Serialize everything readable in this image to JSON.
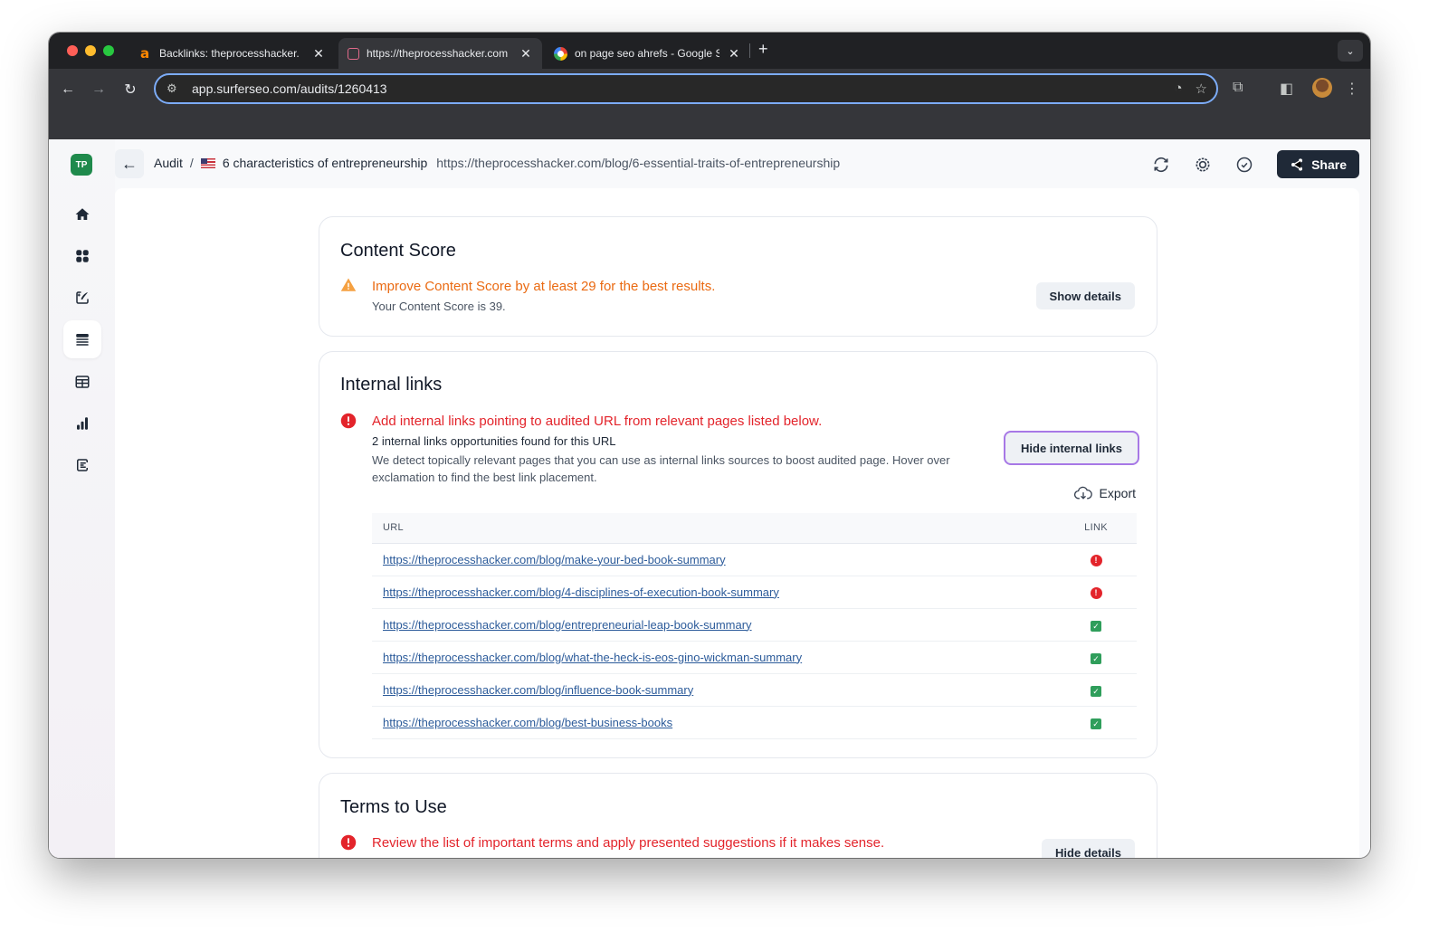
{
  "browser": {
    "tabs": [
      {
        "title": "Backlinks: theprocesshacker.",
        "favicon": "ahrefs-icon",
        "active": false
      },
      {
        "title": "https://theprocesshacker.com",
        "favicon": "surfer-icon",
        "active": true
      },
      {
        "title": "on page seo ahrefs - Google S",
        "favicon": "google-icon",
        "active": false
      }
    ],
    "new_tab_label": "+",
    "address": "app.surferseo.com/audits/1260413"
  },
  "app": {
    "workspace_badge": "TP",
    "sidebar": {
      "items": [
        {
          "name": "home",
          "icon": "home-icon",
          "active": false
        },
        {
          "name": "dashboard",
          "icon": "grid-icon",
          "active": false
        },
        {
          "name": "content-editor",
          "icon": "ai-pen-icon",
          "active": false
        },
        {
          "name": "audit",
          "icon": "list-icon",
          "active": true
        },
        {
          "name": "keyword-research",
          "icon": "table-icon",
          "active": false
        },
        {
          "name": "grow",
          "icon": "bar-chart-icon",
          "active": false
        },
        {
          "name": "outline",
          "icon": "document-icon",
          "active": false
        }
      ]
    },
    "header": {
      "breadcrumb_root": "Audit",
      "separator": "/",
      "country_flag": "US",
      "audit_title": "6 characteristics of entrepreneurship",
      "audit_url": "https://theprocesshacker.com/blog/6-essential-traits-of-entrepreneurship",
      "share_label": "Share"
    },
    "content_score": {
      "title": "Content Score",
      "message": "Improve Content Score by at least 29 for the best results.",
      "sub": "Your Content Score is 39.",
      "button": "Show details",
      "score": 39,
      "improve_by": 29
    },
    "internal_links": {
      "title": "Internal links",
      "message": "Add internal links pointing to audited URL from relevant pages listed below.",
      "count_text": "2 internal links opportunities found for this URL",
      "description": "We detect topically relevant pages that you can use as internal links sources to boost audited page. Hover over exclamation to find the best link placement.",
      "button": "Hide internal links",
      "export_label": "Export",
      "columns": {
        "url": "URL",
        "link": "LINK"
      },
      "rows": [
        {
          "url": "https://theprocesshacker.com/blog/make-your-bed-book-summary",
          "status": "missing",
          "glyph": "!"
        },
        {
          "url": "https://theprocesshacker.com/blog/4-disciplines-of-execution-book-summary",
          "status": "missing",
          "glyph": "!"
        },
        {
          "url": "https://theprocesshacker.com/blog/entrepreneurial-leap-book-summary",
          "status": "linked",
          "glyph": "✓"
        },
        {
          "url": "https://theprocesshacker.com/blog/what-the-heck-is-eos-gino-wickman-summary",
          "status": "linked",
          "glyph": "✓"
        },
        {
          "url": "https://theprocesshacker.com/blog/influence-book-summary",
          "status": "linked",
          "glyph": "✓"
        },
        {
          "url": "https://theprocesshacker.com/blog/best-business-books",
          "status": "linked",
          "glyph": "✓"
        }
      ]
    },
    "terms_to_use": {
      "title": "Terms to Use",
      "message": "Review the list of important terms and apply presented suggestions if it makes sense.",
      "button": "Hide details"
    },
    "help_label": "?",
    "colors": {
      "warning": "#ea6a12",
      "error": "#e3242b",
      "success": "#2f9e5b",
      "link": "#2c5b9a",
      "primary_dark": "#1f2937",
      "focus_outline": "#a778e6"
    }
  }
}
